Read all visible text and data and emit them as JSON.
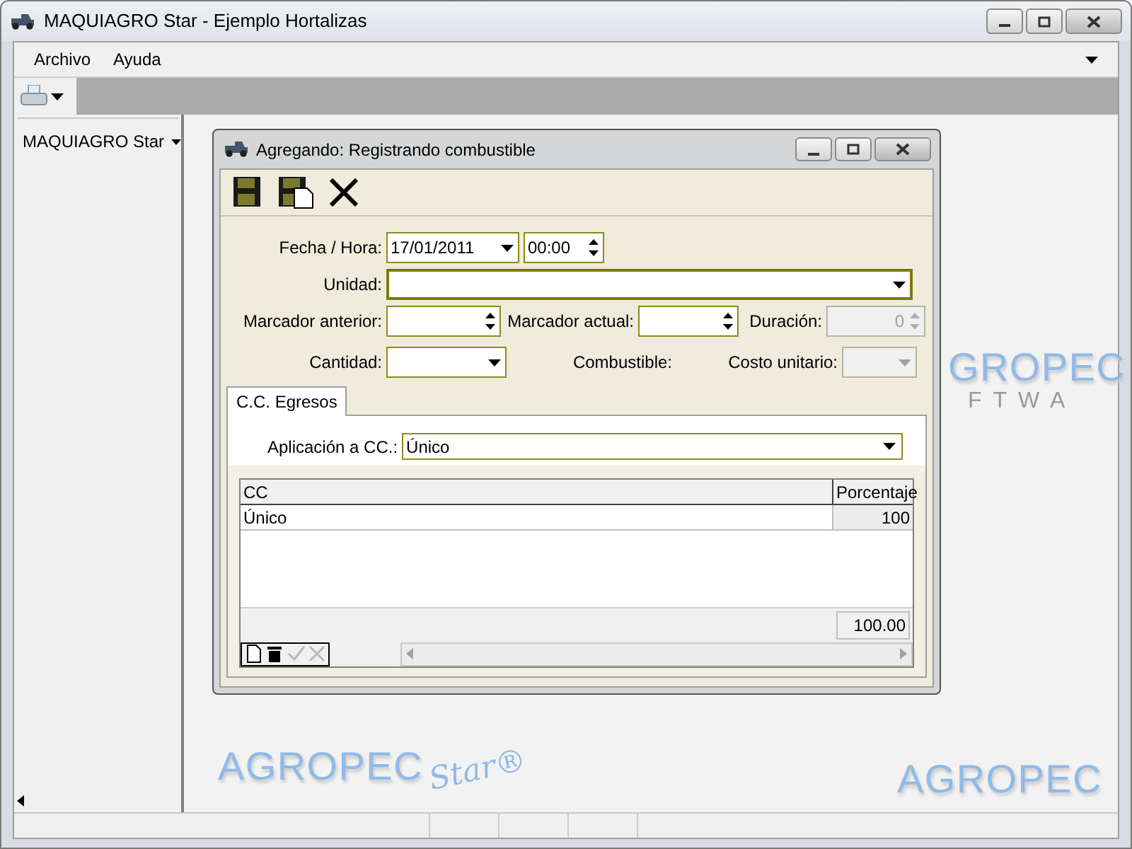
{
  "window": {
    "title": "MAQUIAGRO Star - Ejemplo Hortalizas"
  },
  "menu": [
    {
      "label": "Archivo"
    },
    {
      "label": "Ayuda"
    }
  ],
  "sidebar": {
    "title": "MAQUIAGRO Star"
  },
  "background_logos": [
    {
      "text": "GROPEC",
      "subtext": "FTWA"
    },
    {
      "text": "AGROPEC",
      "subtext": "Star®"
    },
    {
      "text": "AGROPEC"
    }
  ],
  "dialog": {
    "title": "Agregando: Registrando combustible",
    "form": [
      [
        {
          "kind": "label",
          "text": "Fecha / Hora:"
        },
        {
          "kind": "date",
          "value": "17/01/2011",
          "disabled": false,
          "focused": false
        },
        {
          "kind": "spin",
          "value": "00:00",
          "disabled": false,
          "focused": false
        }
      ],
      [
        {
          "kind": "label",
          "text": "Unidad:"
        },
        {
          "kind": "combo",
          "disabled": false,
          "focused": true
        }
      ],
      [
        {
          "kind": "label",
          "text": "Marcador anterior:"
        },
        {
          "kind": "spin",
          "disabled": false,
          "focused": false
        },
        {
          "kind": "label",
          "text": "Marcador actual:"
        },
        {
          "kind": "spin",
          "disabled": false,
          "focused": false
        },
        {
          "kind": "label",
          "text": "Duración:"
        },
        {
          "kind": "spin",
          "value": "0",
          "disabled": true,
          "focused": false
        }
      ],
      [
        {
          "kind": "label",
          "text": "Cantidad:"
        },
        {
          "kind": "combo",
          "disabled": false,
          "focused": false
        },
        {
          "kind": "label",
          "text": "Combustible:"
        },
        {
          "kind": "label",
          "text": "Costo unitario:"
        },
        {
          "kind": "combo",
          "disabled": true,
          "focused": false
        }
      ]
    ],
    "tabs": [
      {
        "label": "C.C. Egresos",
        "selected": true
      }
    ],
    "application": {
      "label": "Aplicación a CC.:",
      "value": "Único"
    },
    "grid": {
      "columns": [
        "CC",
        "Porcentaje"
      ],
      "rows": [
        [
          "Único",
          "100"
        ]
      ],
      "total": "100.00",
      "nav": [
        {
          "kind": "new",
          "disabled": false
        },
        {
          "kind": "delete",
          "disabled": false
        },
        {
          "kind": "confirm",
          "disabled": true
        },
        {
          "kind": "cancel",
          "disabled": true
        }
      ]
    }
  }
}
